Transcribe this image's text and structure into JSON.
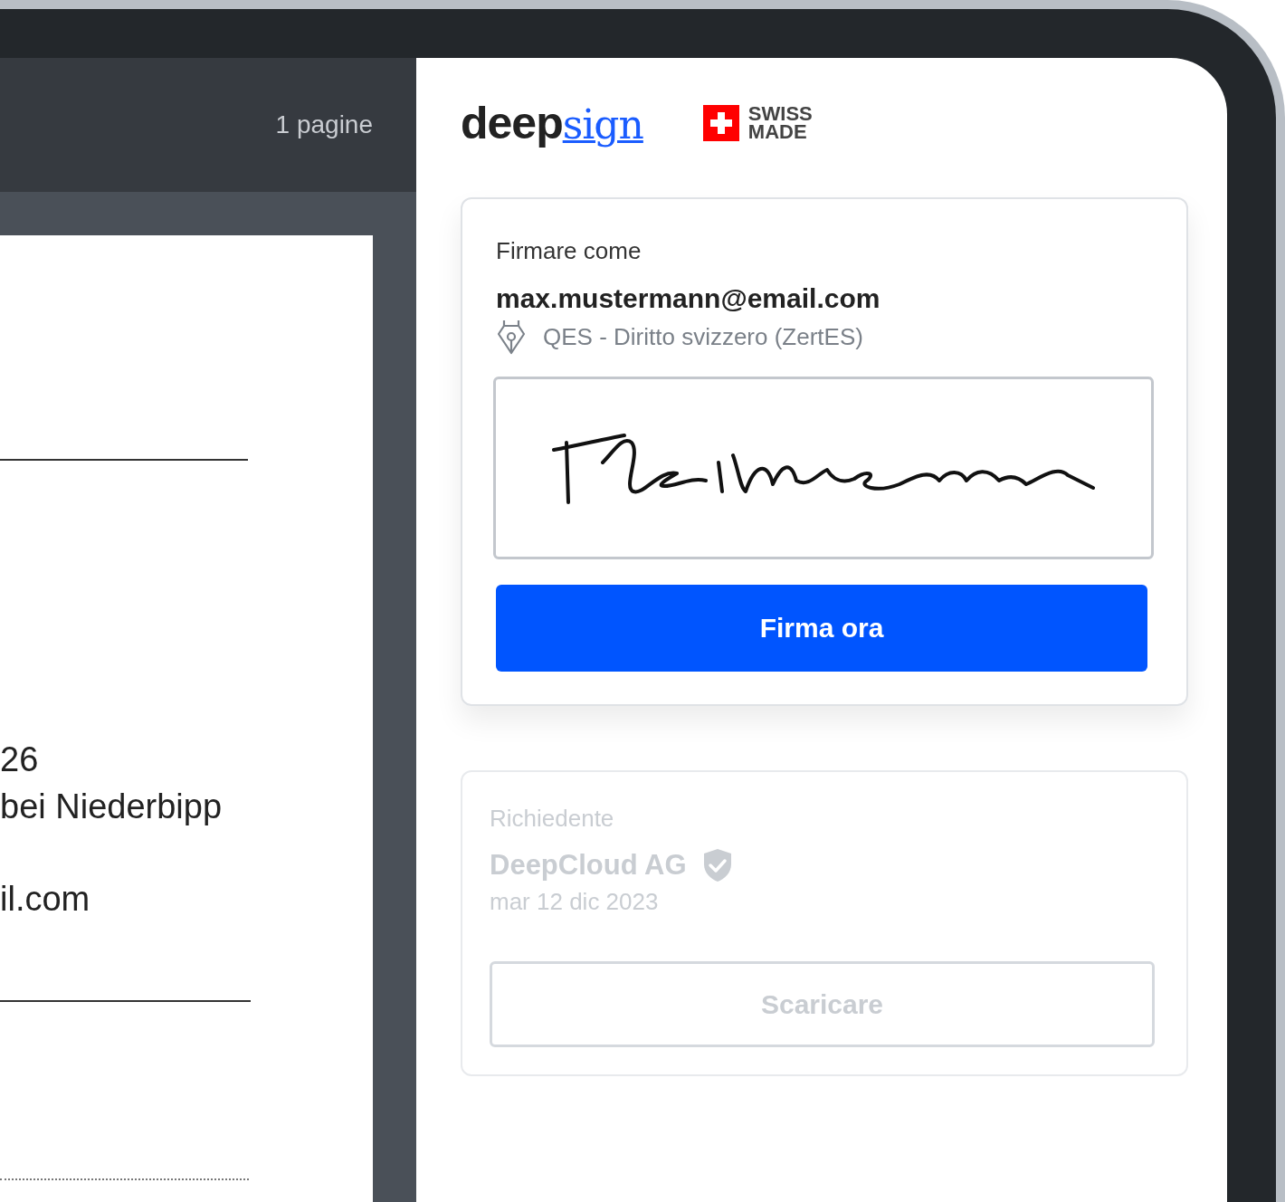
{
  "viewer": {
    "page_count": "1 pagine",
    "document_lines": [
      {
        "kind": "rule"
      },
      {
        "kind": "text",
        "text": "26"
      },
      {
        "kind": "text",
        "text": "bei Niederbipp"
      },
      {
        "kind": "text",
        "text": "il.com"
      },
      {
        "kind": "rule"
      },
      {
        "kind": "dotted"
      }
    ]
  },
  "header": {
    "logo_word": "deep",
    "logo_script": "sign",
    "badge": "SWISS MADE"
  },
  "sign_card": {
    "label": "Firmare come",
    "email": "max.mustermann@email.com",
    "method": "QES - Diritto svizzero (ZertES)",
    "button": "Firma ora"
  },
  "requester_card": {
    "disabled": true,
    "label": "Richiedente",
    "name": "DeepCloud AG",
    "verified": true,
    "date": "mar 12 dic 2023",
    "button": "Scaricare"
  }
}
